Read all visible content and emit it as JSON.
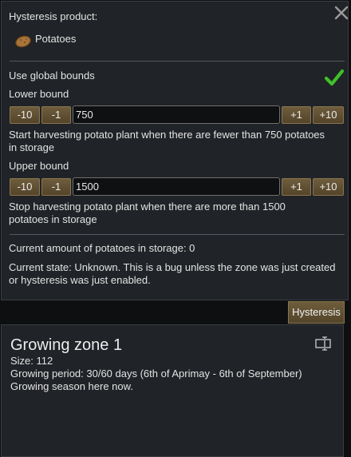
{
  "hysteresis": {
    "product_label": "Hysteresis product:",
    "product_name": "Potatoes",
    "product_icon": "potato-icon",
    "use_global_label": "Use global bounds",
    "use_global_checked": true,
    "lower": {
      "label": "Lower bound",
      "value": "750",
      "description": "Start harvesting potato plant when there are fewer than 750 potatoes in storage"
    },
    "upper": {
      "label": "Upper bound",
      "value": "1500",
      "description": "Stop harvesting potato plant when there are more than 1500 potatoes in storage"
    },
    "buttons": {
      "minus10": "-10",
      "minus1": "-1",
      "plus1": "+1",
      "plus10": "+10"
    },
    "current_amount": "Current amount of potatoes in storage: 0",
    "current_state": "Current state: Unknown. This is a bug unless the zone was just created or hysteresis was just enabled."
  },
  "tab_label": "Hysteresis",
  "zone": {
    "title": "Growing zone 1",
    "size": "Size: 112",
    "growing_period": "Growing period: 30/60 days (6th of Aprimay - 6th of September)",
    "season": "Growing season here now."
  },
  "colors": {
    "panel_bg": "#202327",
    "button_bg": "#6e5d3c",
    "check_green": "#3fbf2a"
  }
}
